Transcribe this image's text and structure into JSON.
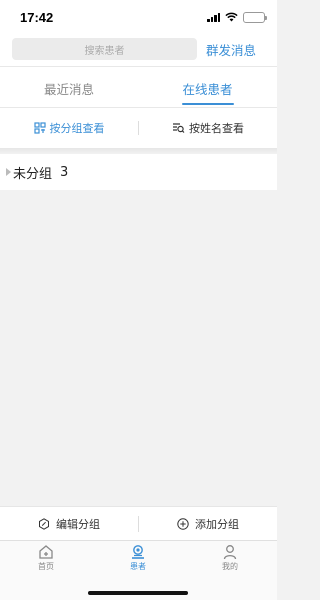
{
  "status_bar": {
    "time": "17:42"
  },
  "search": {
    "placeholder": "搜索患者",
    "mass_message_label": "群发消息"
  },
  "tabs": [
    {
      "label": "最近消息",
      "active": false
    },
    {
      "label": "在线患者",
      "active": true
    }
  ],
  "view_options": {
    "by_group_label": "按分组查看",
    "by_name_label": "按姓名查看"
  },
  "groups": [
    {
      "name": "未分组",
      "count": "3"
    }
  ],
  "actions": {
    "edit_group_label": "编辑分组",
    "add_group_label": "添加分组"
  },
  "tabbar": [
    {
      "label": "首页",
      "icon": "home-icon",
      "active": false
    },
    {
      "label": "患者",
      "icon": "patients-icon",
      "active": true
    },
    {
      "label": "我的",
      "icon": "profile-icon",
      "active": false
    }
  ],
  "colors": {
    "accent": "#3b8fd6",
    "background": "#f2f2f2"
  }
}
